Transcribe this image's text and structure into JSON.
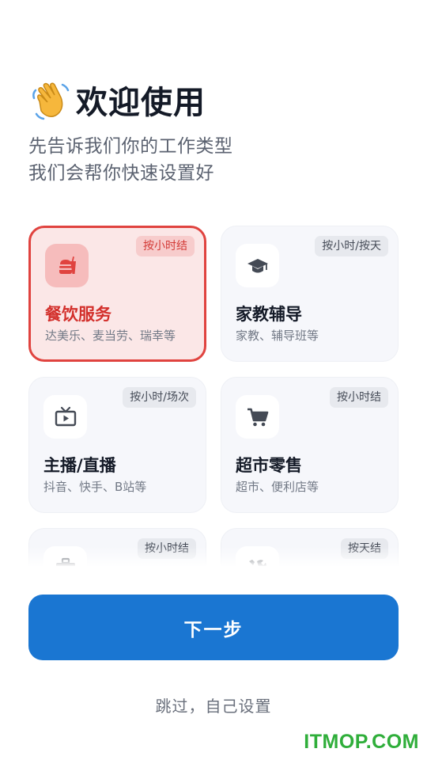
{
  "header": {
    "emoji": "👋",
    "title": "欢迎使用",
    "subtitle_line1": "先告诉我们你的工作类型",
    "subtitle_line2": "我们会帮你快速设置好"
  },
  "categories": [
    {
      "name": "餐饮服务",
      "desc": "达美乐、麦当劳、瑞幸等",
      "tag": "按小时结",
      "icon": "fastfood-icon",
      "selected": true
    },
    {
      "name": "家教辅导",
      "desc": "家教、辅导班等",
      "tag": "按小时/按天",
      "icon": "graduation-cap-icon",
      "selected": false
    },
    {
      "name": "主播/直播",
      "desc": "抖音、快手、B站等",
      "tag": "按小时/场次",
      "icon": "live-tv-icon",
      "selected": false
    },
    {
      "name": "超市零售",
      "desc": "超市、便利店等",
      "tag": "按小时结",
      "icon": "shopping-cart-icon",
      "selected": false
    },
    {
      "name": "",
      "desc": "",
      "tag": "按小时结",
      "icon": "briefcase-icon",
      "selected": false
    },
    {
      "name": "",
      "desc": "",
      "tag": "按天结",
      "icon": "tools-icon",
      "selected": false
    }
  ],
  "actions": {
    "next_label": "下一步",
    "skip_label": "跳过，自己设置"
  },
  "watermark": "ITMOP.COM",
  "colors": {
    "primary": "#1a76d2",
    "selected_accent": "#e0433f",
    "selected_bg": "#fbe7e7",
    "card_bg": "#f6f7fb"
  }
}
